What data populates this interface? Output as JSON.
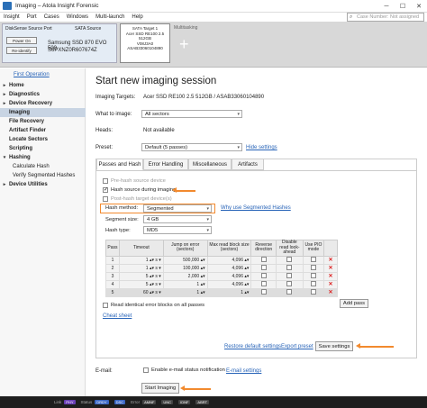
{
  "window": {
    "title": "Imaging – Atola Insight Forensic"
  },
  "menu": [
    "Insight",
    "Port",
    "Cases",
    "Windows",
    "Multi-launch",
    "Help"
  ],
  "search": {
    "placeholder": "Case Number: Not assigned"
  },
  "source": {
    "port_label": "DiskSense Source Port",
    "sata_label": "SATA Source",
    "power_btn": "Power On",
    "reidentify_btn": "Re-identify",
    "model": "Samsung SSD 870 EVO 500",
    "serial": "S6PXNZ0R607674Z"
  },
  "target": {
    "line1": "SATA Target 1",
    "line2": "Acer SSD RE100 2.5",
    "line3": "512GB",
    "line4": "V08J3A0",
    "line5": "ASAB33060104890"
  },
  "multitasking_label": "Multitasking",
  "sidebar": {
    "first_operation": "First Operation",
    "items": [
      {
        "label": "Home",
        "arrow": "▸",
        "sub": false
      },
      {
        "label": "Diagnostics",
        "arrow": "▸",
        "sub": false
      },
      {
        "label": "Device Recovery",
        "arrow": "▸",
        "sub": false
      },
      {
        "label": "Imaging",
        "arrow": "",
        "sub": false
      },
      {
        "label": "File Recovery",
        "arrow": "",
        "sub": false
      },
      {
        "label": "Artifact Finder",
        "arrow": "",
        "sub": false
      },
      {
        "label": "Locate Sectors",
        "arrow": "",
        "sub": false
      },
      {
        "label": "Scripting",
        "arrow": "",
        "sub": false
      },
      {
        "label": "Hashing",
        "arrow": "▾",
        "sub": false
      },
      {
        "label": "Calculate Hash",
        "arrow": "",
        "sub": true
      },
      {
        "label": "Verify Segmented Hashes",
        "arrow": "",
        "sub": true
      },
      {
        "label": "Device Utilities",
        "arrow": "▸",
        "sub": false
      }
    ]
  },
  "main": {
    "title": "Start new imaging session",
    "imaging_targets_label": "Imaging Targets:",
    "imaging_targets_value": "Acer SSD RE100 2.5 512GB / ASAB33060104890",
    "what_to_image_label": "What to image:",
    "what_to_image_value": "All sectors",
    "heads_label": "Heads:",
    "heads_value": "Not available",
    "preset_label": "Preset:",
    "preset_value": "Default (5 passes)",
    "hide_settings": "Hide settings",
    "tabs": [
      "Passes and Hash",
      "Error Handling",
      "Miscellaneous",
      "Artifacts"
    ],
    "prehash_label": "Pre-hash source device",
    "hash_source_label": "Hash source during imaging",
    "posthash_label": "Post-hash target device(s)",
    "hash_method_label": "Hash method:",
    "hash_method_value": "Segmented",
    "why_segmented": "Why use Segmented Hashes",
    "segment_size_label": "Segment size:",
    "segment_size_value": "4 GB",
    "hash_type_label": "Hash type:",
    "hash_type_value": "MD5",
    "table_headers": [
      "Pass",
      "Timeout",
      "Jump on error (sectors)",
      "Max read block size (sectors)",
      "Reverse direction",
      "Disable read look-ahead",
      "Use PIO mode",
      ""
    ],
    "passes": [
      {
        "pass": "1",
        "timeout": "1",
        "unit": "s",
        "jump": "500,000",
        "maxread": "4,096"
      },
      {
        "pass": "2",
        "timeout": "1",
        "unit": "s",
        "jump": "100,000",
        "maxread": "4,096"
      },
      {
        "pass": "3",
        "timeout": "5",
        "unit": "s",
        "jump": "2,000",
        "maxread": "4,096"
      },
      {
        "pass": "4",
        "timeout": "5",
        "unit": "s",
        "jump": "1",
        "maxread": "4,096"
      },
      {
        "pass": "5",
        "timeout": "60",
        "unit": "s",
        "jump": "1",
        "maxread": "1"
      }
    ],
    "add_pass": "Add pass",
    "read_identical_label": "Read identical error blocks on all passes",
    "cheat_sheet": "Cheat sheet",
    "restore_defaults": "Restore default settings",
    "export_preset": "Export preset",
    "save_settings": "Save settings",
    "email_label": "E-mail:",
    "email_notify_label": "Enable e-mail status notification",
    "email_settings": "E-mail settings",
    "start_imaging": "Start Imaging"
  },
  "statusbar": {
    "items": [
      {
        "label": "Link",
        "chip": "PHY",
        "color": "#6a3fb5"
      },
      {
        "label": "Status",
        "chip": "DRDY",
        "color": "#3a66c4"
      },
      {
        "label": "",
        "chip": "DSC",
        "color": "#3a66c4"
      },
      {
        "label": "Error",
        "chip": "AMNF",
        "color": "#444"
      },
      {
        "label": "",
        "chip": "UNC",
        "color": "#444"
      },
      {
        "label": "",
        "chip": "IDNF",
        "color": "#444"
      },
      {
        "label": "",
        "chip": "ABRT",
        "color": "#444"
      }
    ]
  },
  "colors": {
    "highlight": "#f28a2e",
    "link": "#2864b8",
    "accent": "#2a6fb7"
  }
}
